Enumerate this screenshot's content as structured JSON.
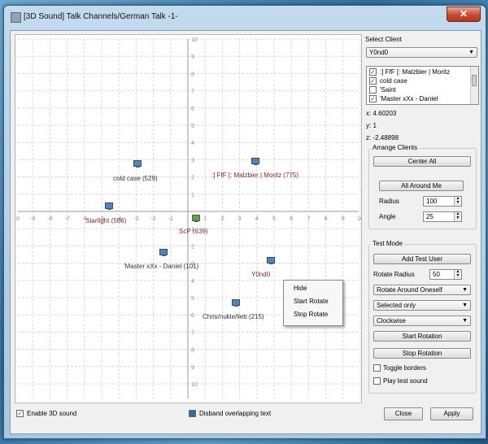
{
  "window": {
    "title": "[3D Sound] Talk Channels/German Talk -1-",
    "close_glyph": "✕"
  },
  "plot": {
    "x_ticks": [
      "-10",
      "-9",
      "-8",
      "-7",
      "-6",
      "-5",
      "-4",
      "-3",
      "-2",
      "-1",
      "1",
      "2",
      "3",
      "4",
      "5",
      "6",
      "7",
      "8",
      "9",
      "10"
    ],
    "y_ticks": [
      "10",
      "9",
      "8",
      "7",
      "6",
      "5",
      "4",
      "3",
      "2",
      "1",
      "1",
      "2",
      "3",
      "4",
      "5",
      "6",
      "7",
      "8",
      "9",
      "10"
    ],
    "clients": [
      {
        "label": "cold case (529)",
        "color": "#333333"
      },
      {
        "label": ":] FfF [: Malzbier | Moritz (775)",
        "color": "#7a2a2a"
      },
      {
        "label": "Starlight (566)",
        "color": "#7a2a2a"
      },
      {
        "label": "ScP (639)",
        "color": "#7a2a2a"
      },
      {
        "label": "'Master xXx - Daniel (101)",
        "color": "#333333"
      },
      {
        "label": "Y0nd0",
        "color": "#7a2a2a"
      },
      {
        "label": "Chris/nukie/lieb (215)",
        "color": "#333333"
      }
    ]
  },
  "context_menu": {
    "items": [
      "Hide",
      "Start Rotate",
      "Stop Rotate"
    ]
  },
  "select_client": {
    "label": "Select Client",
    "selected": "Y0nd0",
    "list": [
      {
        "label": ":] FfF [: Malzbier | Moritz",
        "checked": true
      },
      {
        "label": "cold case",
        "checked": true
      },
      {
        "label": "'Saint",
        "checked": false
      },
      {
        "label": "'Master xXx - Daniel",
        "checked": true
      }
    ]
  },
  "coords": {
    "x": "x: 4.60203",
    "y": "y: 1",
    "z": "z: -2.48898"
  },
  "arrange": {
    "title": "Arrange Clients",
    "center_all": "Center All",
    "all_around_me": "All Around Me",
    "radius_label": "Radius",
    "radius_value": "100",
    "angle_label": "Angle",
    "angle_value": "25"
  },
  "test_mode": {
    "title": "Test Mode",
    "add_test_user": "Add Test User",
    "rotate_radius_label": "Rotate Radius",
    "rotate_radius_value": "50",
    "rotate_mode": "Rotate Around Oneself",
    "selection": "Selected only",
    "direction": "Clockwise",
    "start_rotation": "Start Rotation",
    "stop_rotation": "Stop Rotation",
    "toggle_borders": "Toggle borders",
    "toggle_borders_checked": false,
    "play_test_sound": "Play test sound",
    "play_test_sound_checked": false
  },
  "bottom": {
    "enable_3d_sound": "Enable 3D sound",
    "enable_3d_sound_checked": true,
    "disband_text": "Disband overlapping text",
    "close": "Close",
    "apply": "Apply"
  }
}
